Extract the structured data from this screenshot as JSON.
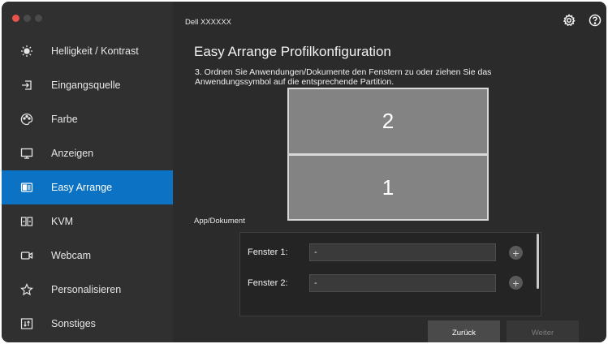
{
  "window": {
    "title": "Dell XXXXXX"
  },
  "sidebar": {
    "items": [
      {
        "label": "Helligkeit / Kontrast",
        "icon": "brightness-icon",
        "active": false
      },
      {
        "label": "Eingangsquelle",
        "icon": "input-source-icon",
        "active": false
      },
      {
        "label": "Farbe",
        "icon": "color-icon",
        "active": false
      },
      {
        "label": "Anzeigen",
        "icon": "display-icon",
        "active": false
      },
      {
        "label": "Easy Arrange",
        "icon": "easy-arrange-icon",
        "active": true
      },
      {
        "label": "KVM",
        "icon": "kvm-icon",
        "active": false
      },
      {
        "label": "Webcam",
        "icon": "webcam-icon",
        "active": false
      },
      {
        "label": "Personalisieren",
        "icon": "star-icon",
        "active": false
      },
      {
        "label": "Sonstiges",
        "icon": "others-icon",
        "active": false
      }
    ]
  },
  "header": {
    "settings_icon": "gear-icon",
    "help_icon": "help-icon"
  },
  "main": {
    "heading": "Easy Arrange Profilkonfiguration",
    "instruction": "3. Ordnen Sie Anwendungen/Dokumente den Fenstern zu oder ziehen Sie das Anwendungssymbol auf die entsprechende Partition.",
    "partitions": [
      {
        "label": "2"
      },
      {
        "label": "1"
      }
    ],
    "app_section_label": "App/Dokument",
    "windows": [
      {
        "label": "Fenster 1:",
        "value": "-"
      },
      {
        "label": "Fenster 2:",
        "value": "-"
      }
    ],
    "add_symbol": "+",
    "buttons": {
      "back": "Zurück",
      "next": "Weiter"
    }
  },
  "colors": {
    "accent": "#0b72c4",
    "close_button": "#e8544c",
    "background": "#2b2b2b",
    "sidebar": "#303030"
  }
}
